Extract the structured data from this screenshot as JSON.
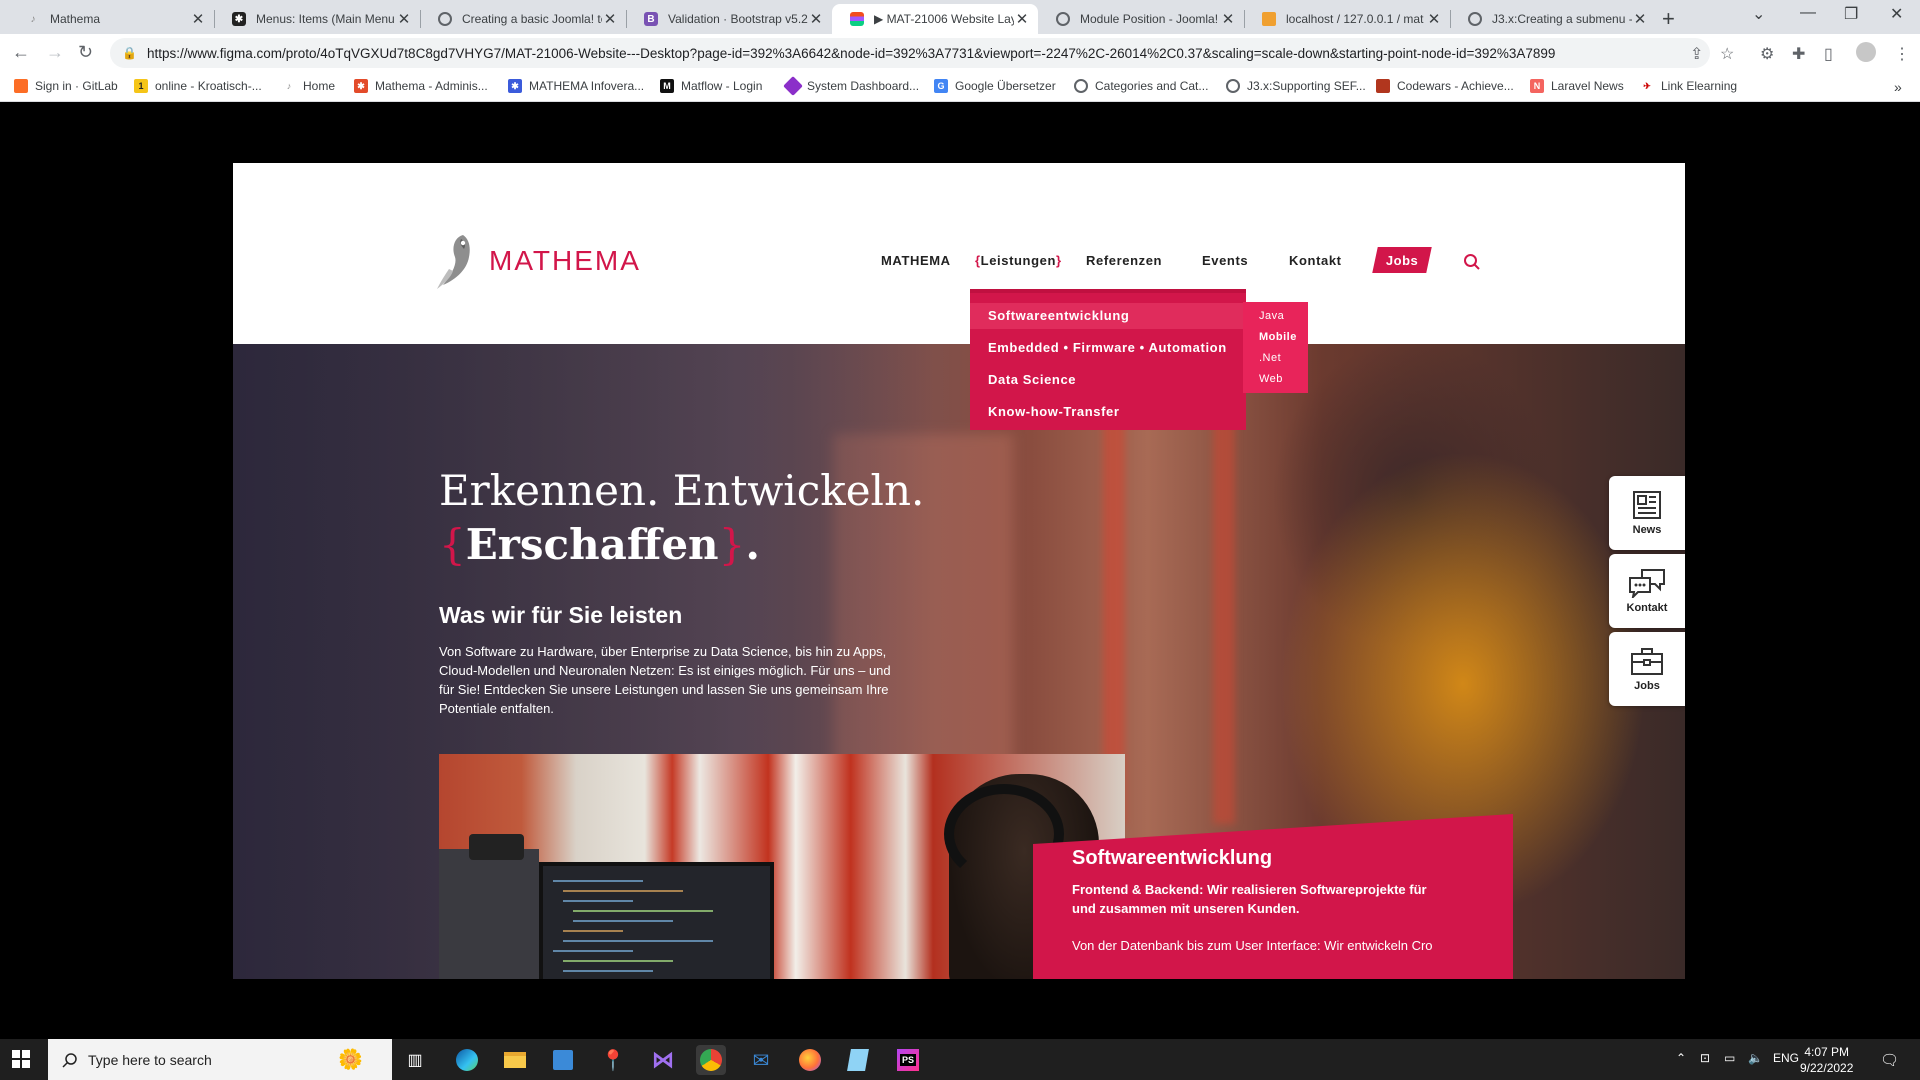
{
  "browser": {
    "tabs": [
      {
        "title": "Mathema"
      },
      {
        "title": "Menus: Items (Main Menu"
      },
      {
        "title": "Creating a basic Joomla! te"
      },
      {
        "title": "Validation · Bootstrap v5.2"
      },
      {
        "title": "▶ MAT-21006 Website Lay"
      },
      {
        "title": "Module Position - Joomla!"
      },
      {
        "title": "localhost / 127.0.0.1 / mat"
      },
      {
        "title": "J3.x:Creating a submenu -"
      }
    ],
    "url": "https://www.figma.com/proto/4oTqVGXUd7t8C8gd7VHYG7/MAT-21006-Website---Desktop?page-id=392%3A6642&node-id=392%3A7731&viewport=-2247%2C-26014%2C0.37&scaling=scale-down&starting-point-node-id=392%3A7899",
    "bookmarks": [
      {
        "label": "Sign in · GitLab"
      },
      {
        "label": "online - Kroatisch-..."
      },
      {
        "label": "Home"
      },
      {
        "label": "Mathema - Adminis..."
      },
      {
        "label": "MATHEMA Infovera..."
      },
      {
        "label": "Matflow - Login"
      },
      {
        "label": "System Dashboard..."
      },
      {
        "label": "Google Übersetzer"
      },
      {
        "label": "Categories and Cat..."
      },
      {
        "label": "J3.x:Supporting SEF..."
      },
      {
        "label": "Codewars - Achieve..."
      },
      {
        "label": "Laravel News"
      },
      {
        "label": "Link Elearning"
      }
    ]
  },
  "site": {
    "logo_text": "MATHEMA",
    "nav": {
      "mathema": "MATHEMA",
      "leistungen": "Leistungen",
      "brace_open": "{",
      "brace_close": "}",
      "referenzen": "Referenzen",
      "events": "Events",
      "kontakt": "Kontakt",
      "jobs": "Jobs"
    },
    "dropdown": [
      "Softwareentwicklung",
      "Embedded • Firmware • Automation",
      "Data Science",
      "Know-how-Transfer"
    ],
    "submenu": [
      "Java",
      "Mobile",
      ".Net",
      "Web"
    ],
    "hero": {
      "line1": "Erkennen. Entwickeln.",
      "line2_open": "{",
      "line2": "Erschaffen",
      "line2_close": "}",
      "line2_dot": ".",
      "subtitle": "Was wir für Sie leisten",
      "paragraph": "Von Software zu Hardware, über Enterprise zu Data Science, bis hin zu Apps, Cloud-Modellen und Neuronalen Netzen: Es ist einiges möglich. Für uns – und für Sie! Entdecken Sie unsere Leistungen und lassen Sie uns gemeinsam Ihre Potentiale entfalten."
    },
    "card": {
      "title": "Softwareentwicklung",
      "subtitle": "Frontend & Backend: Wir realisieren Softwareprojekte für und zusammen mit unseren Kunden.",
      "text": "Von der Datenbank bis zum User Interface: Wir entwickeln Cross-Platform-Software, die auch"
    },
    "side_widgets": {
      "news": "News",
      "kontakt": "Kontakt",
      "jobs": "Jobs"
    }
  },
  "taskbar": {
    "search_placeholder": "Type here to search",
    "lang": "ENG",
    "time": "4:07 PM",
    "date": "9/22/2022"
  },
  "colors": {
    "brand": "#d2164a"
  }
}
